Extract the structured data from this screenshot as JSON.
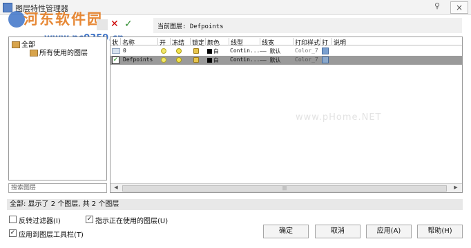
{
  "window": {
    "title": "图层特性管理器",
    "pin_glyph": "♀",
    "close_glyph": "×"
  },
  "watermark": {
    "brand": "河东软件园",
    "url": "www.pc0359.cn",
    "center_text": "www.pHome.NET"
  },
  "toolbar": {
    "current_layer_label": "当前图层: Defpoints"
  },
  "tree": {
    "root_label": "全部",
    "child_label": "所有使用的图层"
  },
  "search": {
    "placeholder": "搜索图层"
  },
  "grid": {
    "headers": [
      "状",
      "名称",
      "开",
      "冻结",
      "锁定",
      "颜色",
      "线型",
      "线宽",
      "打印样式",
      "打",
      "说明"
    ],
    "rows": [
      {
        "name": "0",
        "color": "白",
        "linetype": "Contin...",
        "lineweight": "—— 默认",
        "plot_style": "Color_7",
        "selected": false
      },
      {
        "name": "Defpoints",
        "color": "白",
        "linetype": "Contin...",
        "lineweight": "—— 默认",
        "plot_style": "Color_7",
        "selected": true
      }
    ],
    "scroll_thumb": "|||"
  },
  "summary": {
    "text": "全部: 显示了 2 个图层, 共 2 个图层"
  },
  "options": {
    "invert_filter": {
      "label": "反转过滤器(I)",
      "checked": false
    },
    "apply_to_toolbar": {
      "label": "应用到图层工具栏(T)",
      "checked": true
    },
    "indicate_used": {
      "label": "指示正在使用的图层(U)",
      "checked": true
    }
  },
  "buttons": {
    "ok": "确定",
    "cancel": "取消",
    "apply": "应用(A)",
    "help": "帮助(H)"
  },
  "colors": {
    "selected_row": "#9a9a9a",
    "watermark_orange": "#e47b1f",
    "watermark_blue": "#3d73c8"
  }
}
